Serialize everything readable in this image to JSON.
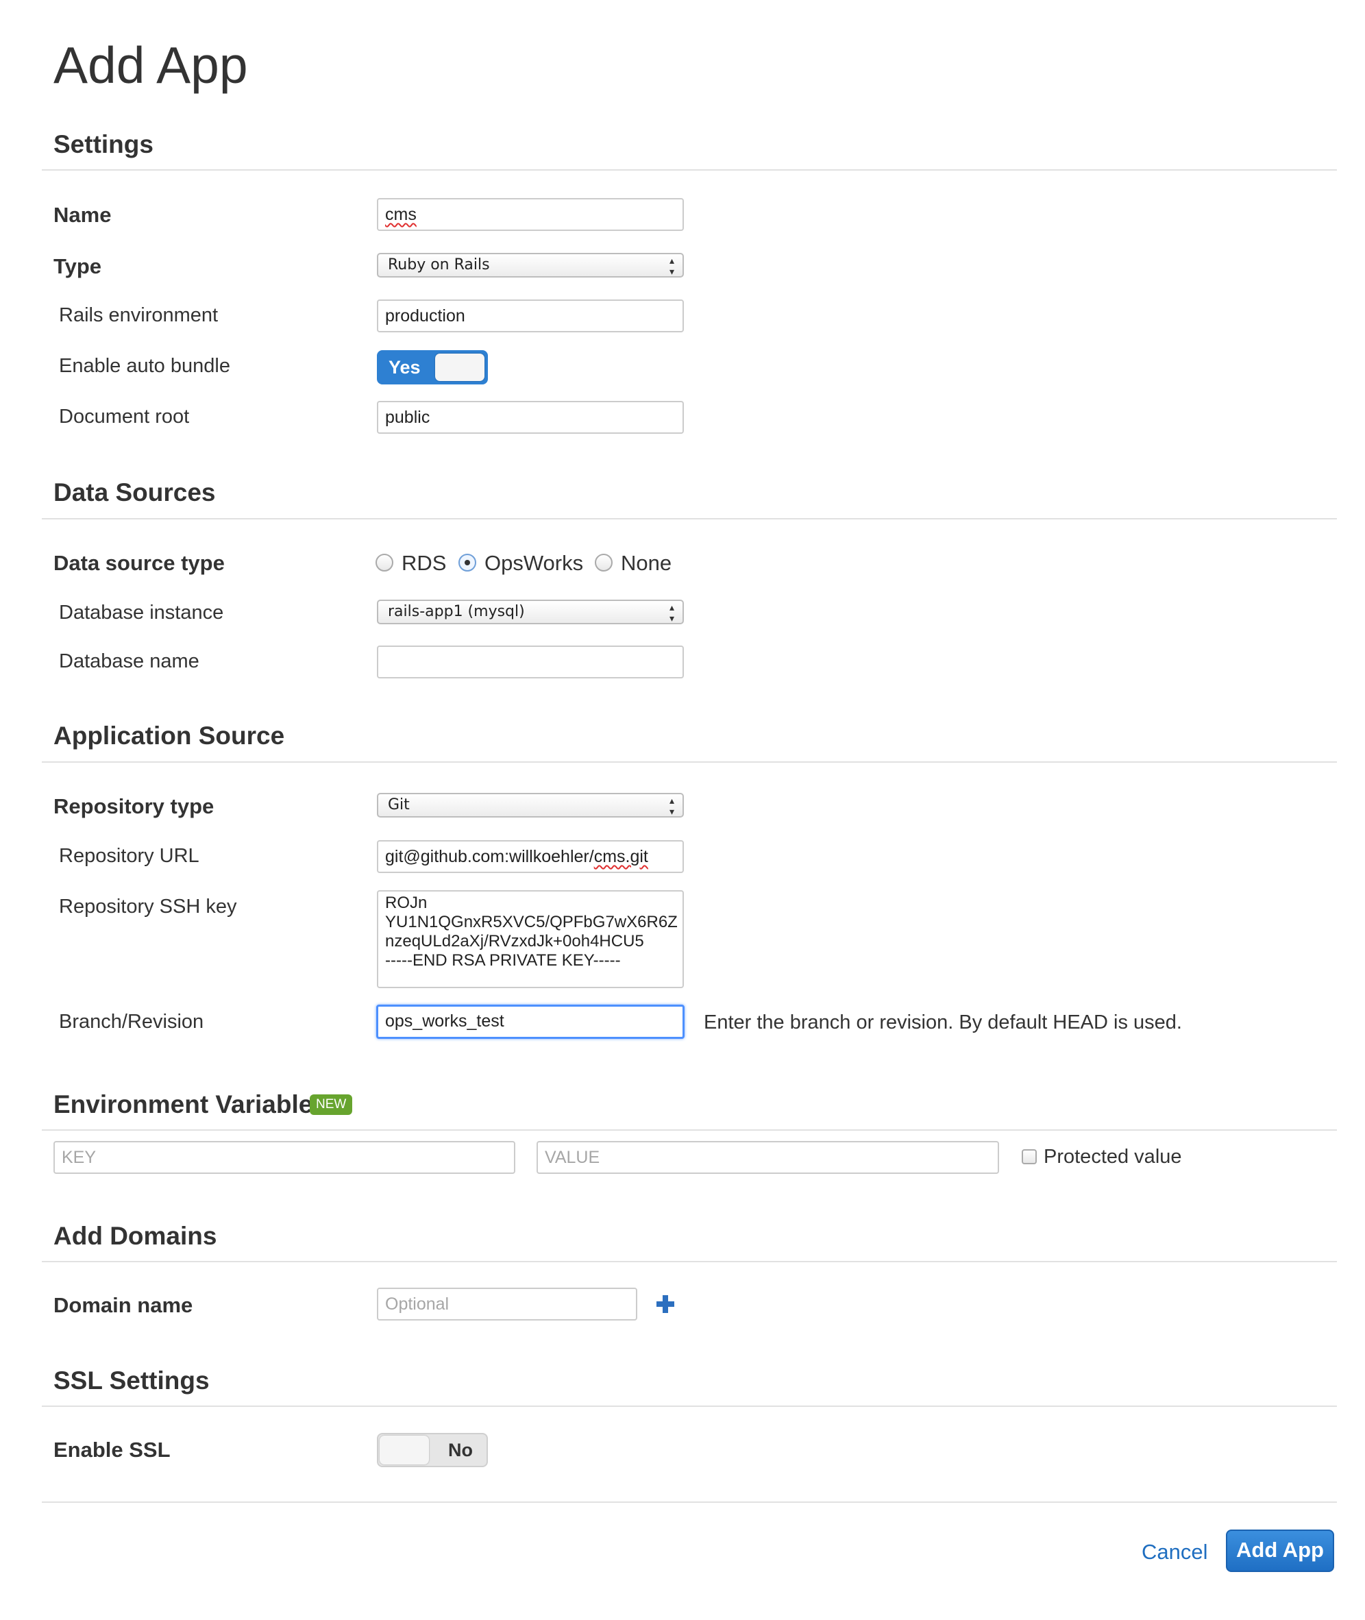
{
  "page": {
    "title": "Add App"
  },
  "settings": {
    "title": "Settings",
    "name": {
      "label": "Name",
      "value": "cms"
    },
    "type": {
      "label": "Type",
      "value": "Ruby on Rails"
    },
    "rails_env": {
      "label": "Rails environment",
      "value": "production"
    },
    "auto_bundle": {
      "label": "Enable auto bundle",
      "state": "Yes"
    },
    "document_root": {
      "label": "Document root",
      "value": "public"
    }
  },
  "data_sources": {
    "title": "Data Sources",
    "type": {
      "label": "Data source type",
      "options": [
        "RDS",
        "OpsWorks",
        "None"
      ],
      "selected": "OpsWorks"
    },
    "instance": {
      "label": "Database instance",
      "value": "rails-app1 (mysql)"
    },
    "db_name": {
      "label": "Database name",
      "value": ""
    }
  },
  "app_source": {
    "title": "Application Source",
    "repo_type": {
      "label": "Repository type",
      "value": "Git"
    },
    "repo_url": {
      "label": "Repository URL",
      "value_prefix": "git@github.com:willkoehler/",
      "value_suffix": "cms.git"
    },
    "ssh_key": {
      "label": "Repository SSH key",
      "lines": [
        "ROJn",
        "YU1N1QGnxR5XVC5/QPFbG7wX6R6Z",
        "nzeqULd2aXj/RVzxdJk+0oh4HCU5",
        "-----END RSA PRIVATE KEY-----"
      ]
    },
    "branch": {
      "label": "Branch/Revision",
      "value": "ops_works_test",
      "help": "Enter the branch or revision. By default HEAD is used."
    }
  },
  "env_vars": {
    "title": "Environment Variables",
    "badge": "NEW",
    "key_placeholder": "KEY",
    "value_placeholder": "VALUE",
    "protected_label": "Protected value"
  },
  "domains": {
    "title": "Add Domains",
    "label": "Domain name",
    "placeholder": "Optional"
  },
  "ssl": {
    "title": "SSL Settings",
    "label": "Enable SSL",
    "state": "No"
  },
  "footer": {
    "cancel": "Cancel",
    "submit": "Add App"
  },
  "colors": {
    "accent": "#2e80d2",
    "link": "#1f6ec0",
    "badge": "#67a42e",
    "focus": "#4d90fe"
  }
}
